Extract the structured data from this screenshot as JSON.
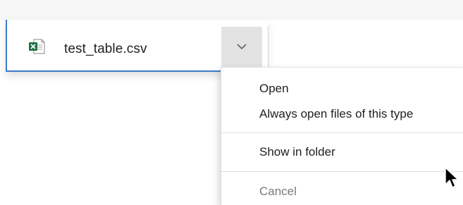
{
  "download": {
    "file_name": "test_table.csv",
    "file_icon": "excel-csv-file-icon",
    "menu_toggle_icon": "chevron-down-icon"
  },
  "context_menu": {
    "items": [
      {
        "label": "Open",
        "enabled": true
      },
      {
        "label": "Always open files of this type",
        "enabled": true
      },
      {
        "label": "Show in folder",
        "enabled": true
      },
      {
        "label": "Cancel",
        "enabled": false
      }
    ]
  },
  "colors": {
    "accent": "#3d7cc9",
    "excel_green": "#1e7145",
    "chevron_button_bg": "#e3e3e3"
  },
  "cursor_icon": "mouse-pointer-icon"
}
